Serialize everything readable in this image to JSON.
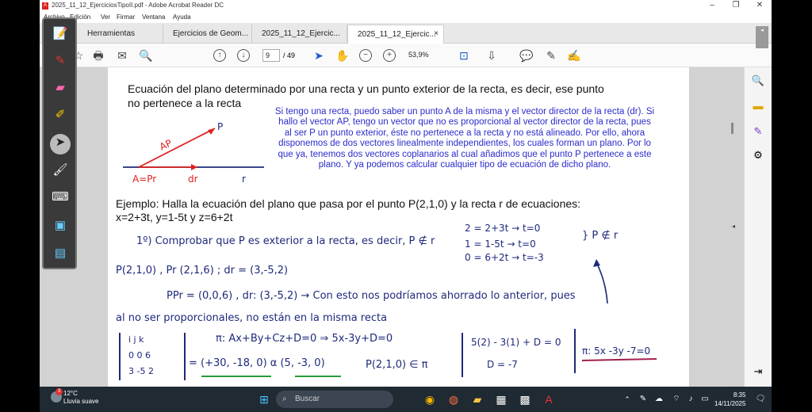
{
  "window": {
    "title": "2025_11_12_EjerciciosTipoII.pdf - Adobe Acrobat Reader DC"
  },
  "menu": [
    "Archivo",
    "Edición",
    "Ver",
    "Firmar",
    "Ventana",
    "Ayuda"
  ],
  "tabs": [
    {
      "label": "Herramientas"
    },
    {
      "label": "Ejercicios de Geom..."
    },
    {
      "label": "2025_11_12_Ejercic..."
    },
    {
      "label": "2025_11_12_Ejercic...",
      "close": "×"
    }
  ],
  "toolbar": {
    "page_current": "9",
    "page_sep": "/ 49",
    "zoom": "53,9%"
  },
  "page": {
    "heading1": "Ecuación del plano determinado por una recta y un punto exterior de la recta, es decir, ese punto",
    "heading2": "no pertenece a la recta",
    "blue_text": "Si tengo una recta, puedo saber un punto A de la misma y el vector director de la recta (dr). Si hallo el vector AP, tengo un vector que no es proporcional al vector director de la recta, pues al ser P un punto exterior, éste no pertenece a la recta y no está alineado. Por ello, ahora disponemos de dos vectores linealmente independientes, los cuales forman un plano. Por lo que ya, tenemos dos vectores coplanarios al cual añadimos que el punto P pertenece a este plano. Y ya podemos calcular cualquier tipo de ecuación de dicho plano.",
    "example1": "Ejemplo: Halla la ecuación del plano que pasa por el punto P(2,1,0) y la recta r de ecuaciones:",
    "example2": "x=2+3t, y=1-5t y z=6+2t",
    "diagram": {
      "P": "P",
      "AP": "AP",
      "A": "A=Pr",
      "dr": "dr",
      "r": "r"
    },
    "handwriting": {
      "l1": "1º) Comprobar que P es exterior a la recta, es decir, P ∉ r",
      "l2": "P(2,1,0) , Pr (2,1,6) ; dr = (3,-5,2)",
      "l3": "PPr = (0,0,6) , dr: (3,-5,2) → Con esto nos podríamos ahorrado lo anterior, pues",
      "l4": "al no ser proporcionales, no están en la misma recta",
      "s1": "2 = 2+3t → t=0",
      "s2": "1 = 1-5t → t=0",
      "s3": "0 = 6+2t → t=-3",
      "s4": "} P ∉ r",
      "m1": "i   j   k",
      "m2": "0   0   6",
      "m3": "3  -5   2",
      "eq1": "π: Ax+By+Cz+D=0 ⇒ 5x-3y+D=0",
      "eq2": "= (+30, -18, 0) α (5, -3, 0)",
      "eq3": "P(2,1,0) ∈ π",
      "eq4": "5(2) - 3(1) + D = 0",
      "eq5": "D = -7",
      "eq6": "π: 5x -3y -7=0"
    }
  },
  "taskbar": {
    "temp": "12°C",
    "weather": "Lluvia suave",
    "search": "Buscar",
    "time": "8:35",
    "date": "14/11/2025",
    "badge": "3"
  }
}
